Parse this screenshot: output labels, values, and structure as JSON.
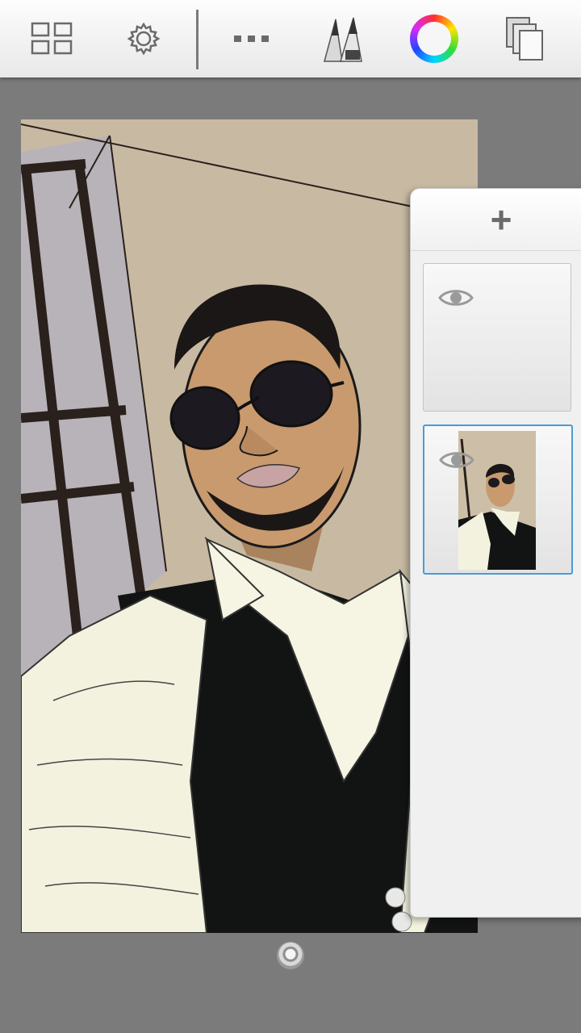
{
  "app": {
    "toolbar": {
      "buttons": [
        {
          "icon": "gallery-grid-icon"
        },
        {
          "icon": "settings-gear-icon"
        },
        {
          "icon": "more-dots-icon"
        },
        {
          "icon": "brush-tools-icon"
        },
        {
          "icon": "color-wheel-icon"
        },
        {
          "icon": "layers-icon"
        }
      ]
    },
    "colors": {
      "background": "#7b7b7b",
      "toolbar": "#f2f2f2",
      "selected_layer_border": "#4a9bd8",
      "panel": "#f0f0f0"
    },
    "layers_panel": {
      "add_label": "+",
      "layers": [
        {
          "name": "empty-layer",
          "visible": true,
          "selected": false
        },
        {
          "name": "drawing-layer",
          "visible": true,
          "selected": true
        }
      ]
    }
  }
}
